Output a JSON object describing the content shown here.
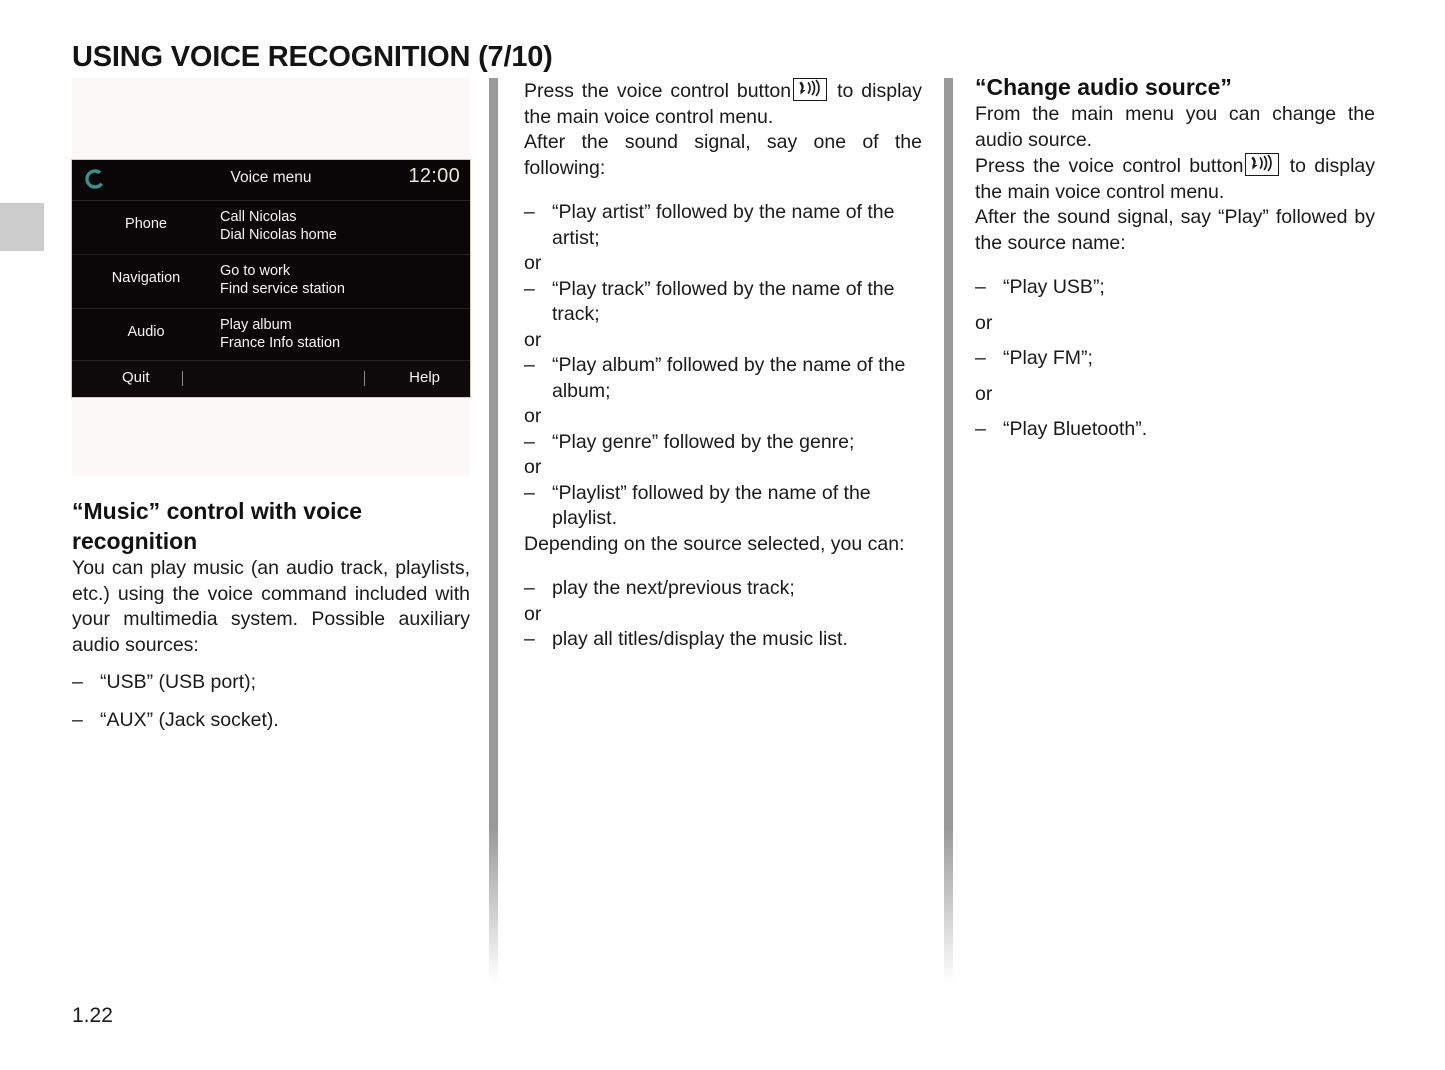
{
  "page": {
    "title": "USING VOICE RECOGNITION (7/10)",
    "number": "1.22"
  },
  "illustration": {
    "name": "voice-menu-screen",
    "header": {
      "icon": "voice-ring-icon",
      "title": "Voice menu",
      "clock": "12:00"
    },
    "rows": [
      {
        "category": "Phone",
        "command_1": "Call Nicolas",
        "command_2": "Dial Nicolas home"
      },
      {
        "category": "Navigation",
        "command_1": "Go to work",
        "command_2": "Find service station"
      },
      {
        "category": "Audio",
        "command_1": "Play album",
        "command_2": "France Info station"
      }
    ],
    "footer": {
      "quit": "Quit",
      "help": "Help"
    },
    "colors": {
      "screen_background": "#0a0709",
      "ring_accent": "#3f8e8c",
      "clock_text": "#efe3dd",
      "text": "#f5f5f5"
    }
  },
  "left_column": {
    "heading": "“Music” control with voice recognition",
    "paragraph": "You can play music (an audio track, playlists, etc.) using the voice command included with your multimedia system. Possible auxiliary audio sources:",
    "items": [
      "“USB” (USB port);",
      "“AUX” (Jack socket)."
    ],
    "dash": "–"
  },
  "middle_column": {
    "intro_before_icon": "Press the voice control button",
    "intro_icon": "voice-control-button-icon",
    "intro_after_icon": "to display the main voice control menu.",
    "say_one_of": "After the sound signal, say one of the following:",
    "options": [
      "“Play artist” followed by the name of the artist;",
      "“Play track” followed by the name of the track;",
      "“Play album” followed by the name of the album;",
      "“Play genre” followed by the genre;",
      "“Playlist” followed by the name of the playlist."
    ],
    "or": "or",
    "dash": "–",
    "depending": "Depending on the source selected, you can:",
    "actions": [
      "play the next/previous track;",
      "play all titles/display the music list."
    ]
  },
  "right_column": {
    "heading": "“Change audio source”",
    "paragraph": "From the main menu you can change the audio source.",
    "intro_before_icon": "Press the voice control button",
    "intro_icon": "voice-control-button-icon",
    "intro_after_icon": "to display the main voice control menu.",
    "say_play": "After the sound signal, say “Play” followed by the source name:",
    "sources": [
      "“Play USB”;",
      "“Play FM”;",
      "“Play Bluetooth”."
    ],
    "or": "or",
    "dash": "–"
  }
}
